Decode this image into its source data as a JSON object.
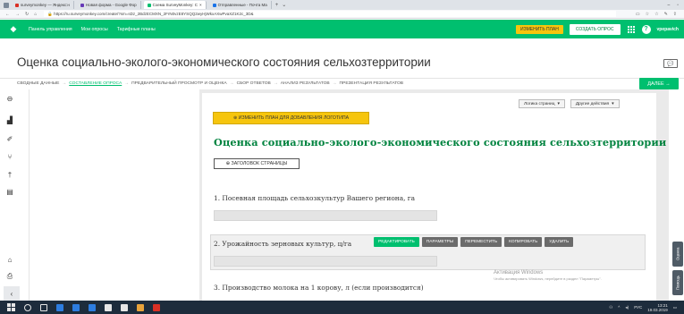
{
  "browser": {
    "tabs": [
      {
        "label": "surveymonkey — Яндекс:н",
        "color": "#d93025"
      },
      {
        "label": "Новая форма - Google Фор",
        "color": "#673ab7"
      },
      {
        "label": "Схема SurveyMonkey: С",
        "color": "#00bf6f"
      },
      {
        "label": "Отправленные - Почта Ma",
        "color": "#1a73e8"
      }
    ],
    "url": "https://ru.surveymonkey.com/create/?sm=sDz_2BdzECMXN_2FrN0vzE8YSQQ2wyHjWkxAXwPvaXZ1K2c_3D&"
  },
  "app_nav": {
    "dashboard": "Панель управления",
    "my_surveys": "Мои опросы",
    "plans": "Тарифные планы",
    "upgrade": "ИЗМЕНИТЬ ПЛАН",
    "create_survey": "СОЗДАТЬ ОПРОС",
    "help": "?",
    "user": "vpepavich"
  },
  "page": {
    "title": "Оценка социально-эколого-экономического состояния сельхозтерритории"
  },
  "steps": {
    "items": [
      "СВОДНЫЕ ДАННЫЕ",
      "СОСТАВЛЕНИЕ ОПРОСА",
      "ПРЕДВАРИТЕЛЬНЫЙ ПРОСМОТР И ОЦЕНКА",
      "СБОР ОТВЕТОВ",
      "АНАЛИЗ РЕЗУЛЬТАТОВ",
      "ПРЕЗЕНТАЦИЯ РЕЗУЛЬТАТОВ"
    ],
    "next": "ДАЛЕЕ →"
  },
  "toolbar": {
    "page_logic": "Логика страниц",
    "other_actions": "Другие действия"
  },
  "editor": {
    "logo_notice": "⊕ ИЗМЕНИТЬ ПЛАН ДЛЯ ДОБАВЛЕНИЯ ЛОГОТИПА",
    "survey_title": "Оценка социально-эколого-экономического состояния сельхозтерритории",
    "page_header_btn": "⊕ ЗАГОЛОВОК СТРАНИЦЫ",
    "questions": [
      "1. Посевная площадь сельхозкультур Вашего региона, га",
      "2. Урожайность зерновых культур, ц/га",
      "3. Производство молока на 1 корову, л (если производится)"
    ],
    "question_actions": [
      "РЕДАКТИРОВАТЬ",
      "ПАРАМЕТРЫ",
      "ПЕРЕМЕСТИТЬ",
      "КОПИРОВАТЬ",
      "УДАЛИТЬ"
    ]
  },
  "side_tabs": [
    "Оценка",
    "Помощь"
  ],
  "watermark": {
    "title": "Активация Windows",
    "subtitle": "Чтобы активировать Windows, перейдите в раздел \"Параметры\"."
  },
  "taskbar": {
    "lang": "РУС",
    "time": "13:21",
    "date": "19.03.2019"
  },
  "colors": {
    "brand_green": "#00bf6f",
    "title_green": "#00833f",
    "upgrade_yellow": "#f6c50d"
  }
}
